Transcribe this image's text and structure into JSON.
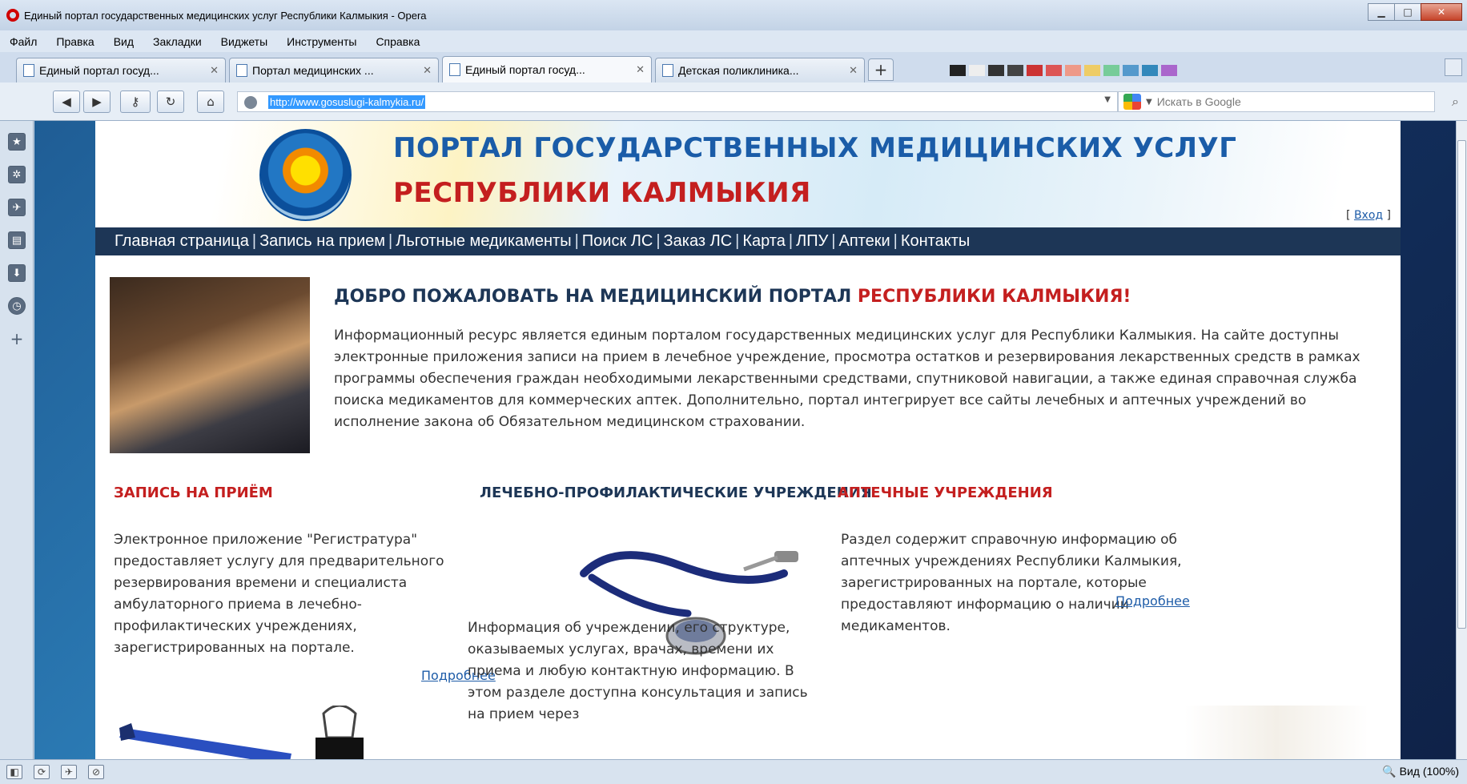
{
  "window": {
    "title": "Единый портал государственных медицинских услуг Республики Калмыкия - Opera"
  },
  "menu": [
    "Файл",
    "Правка",
    "Вид",
    "Закладки",
    "Виджеты",
    "Инструменты",
    "Справка"
  ],
  "tabs": [
    {
      "label": "Единый портал госуд..."
    },
    {
      "label": "Портал медицинских ..."
    },
    {
      "label": "Единый портал госуд..."
    },
    {
      "label": "Детская поликлиника..."
    }
  ],
  "address": {
    "url": "http://www.gosuslugi-kalmykia.ru/",
    "search_placeholder": "Искать в Google"
  },
  "site": {
    "title_line1": "ПОРТАЛ ГОСУДАРСТВЕННЫХ МЕДИЦИНСКИХ УСЛУГ",
    "title_line2": "РЕСПУБЛИКИ КАЛМЫКИЯ",
    "login": "Вход",
    "nav": [
      "Главная страница",
      "Запись на прием",
      "Льготные медикаменты",
      "Поиск ЛС",
      "Заказ ЛС",
      "Карта",
      "ЛПУ",
      "Аптеки",
      "Контакты"
    ],
    "welcome_title_part1": "ДОБРО ПОЖАЛОВАТЬ НА МЕДИЦИНСКИЙ ПОРТАЛ",
    "welcome_title_part2": "РЕСПУБЛИКИ КАЛМЫКИЯ!",
    "welcome_text": "Информационный ресурс является единым порталом государственных медицинских услуг для Республики Калмыкия.  На сайте доступны электронные приложения записи на прием в лечебное учреждение, просмотра остатков и резервирования лекарственных средств в рамках программы обеспечения граждан необходимыми лекарственными средствами, спутниковой навигации, а также единая справочная служба поиска медикаментов для коммерческих аптек. Дополнительно, портал интегрирует все сайты лечебных и аптечных учреждений во исполнение закона об Обязательном медицинском страховании.",
    "col1": {
      "title": "ЗАПИСЬ НА ПРИЁМ",
      "text": "Электронное приложение \"Регистратура\" предоставляет услугу для предварительного резервирования времени и специалиста амбулаторного приема в лечебно-профилактических учреждениях, зарегистрированных на портале.",
      "more": "Подробнее"
    },
    "col2": {
      "title": "ЛЕЧЕБНО-ПРОФИЛАКТИЧЕСКИЕ УЧРЕЖДЕНИЯ",
      "text": "Информация об учреждении, его структуре, оказываемых услугах, врачах, времени их приема и любую контактную информацию. В этом разделе доступна консультация и запись на прием через"
    },
    "col3": {
      "title": "АПТЕЧНЫЕ УЧРЕЖДЕНИЯ",
      "text": "Раздел содержит справочную информацию об аптечных учреждениях Республики Калмыкия, зарегистрированных на портале, которые предоставляют информацию о наличии медикаментов.",
      "more": "Подробнее"
    }
  },
  "status": {
    "zoom": "Вид (100%)"
  },
  "colors": {
    "nav_bg": "#1d3656",
    "accent_red": "#c41f1f",
    "accent_blue": "#1a5ca8"
  }
}
